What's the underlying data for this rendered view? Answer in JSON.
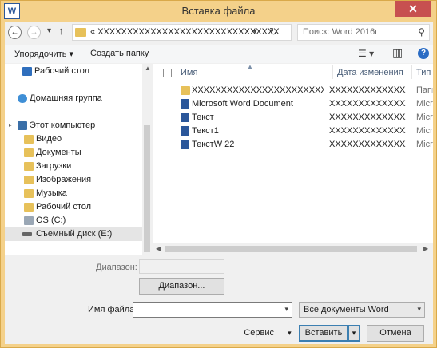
{
  "window": {
    "app_icon_letter": "W",
    "title": "Вставка файла",
    "close_glyph": "✕"
  },
  "nav": {
    "back_glyph": "←",
    "forward_glyph": "→",
    "recent_glyph": "▾",
    "up_glyph": "↑",
    "address_prefix": "«",
    "address_path": "XXXXXXXXXXXXXXXXXXXXXXXXXXXXXXX",
    "address_dropdown_glyph": "▾",
    "refresh_glyph": "↻",
    "search_placeholder": "Поиск: Word 2016г",
    "search_glyph": "⚲"
  },
  "toolbar": {
    "organize_label": "Упорядочить ▾",
    "new_folder_label": "Создать папку",
    "view_glyph": "☰ ▾",
    "preview_glyph": "▥",
    "help_glyph": "?"
  },
  "sidebar": {
    "items": [
      {
        "label": "Рабочий стол",
        "icon": "desktop-icon"
      },
      {
        "label": "Домашняя группа",
        "icon": "homegroup-icon"
      },
      {
        "label": "Этот компьютер",
        "icon": "computer-icon"
      },
      {
        "label": "Видео",
        "icon": "folder-icon"
      },
      {
        "label": "Документы",
        "icon": "folder-icon"
      },
      {
        "label": "Загрузки",
        "icon": "folder-icon"
      },
      {
        "label": "Изображения",
        "icon": "folder-icon"
      },
      {
        "label": "Музыка",
        "icon": "folder-icon"
      },
      {
        "label": "Рабочий стол",
        "icon": "folder-icon"
      },
      {
        "label": "OS (C:)",
        "icon": "drive-icon"
      },
      {
        "label": "Съемный диск (E:)",
        "icon": "removable-drive-icon",
        "selected": true
      }
    ],
    "expand_glyph": "▸"
  },
  "files": {
    "columns": [
      "Имя",
      "Дата изменения",
      "Тип"
    ],
    "rows": [
      {
        "name": "XXXXXXXXXXXXXXXXXXXXXXXXXXXX",
        "date": "XXXXXXXXXXXXXXX",
        "type": "Папка",
        "icon": "folder-icon"
      },
      {
        "name": "Microsoft Word Document",
        "date": "XXXXXXXXXXXXXXX",
        "type": "Micros",
        "icon": "word-doc-icon"
      },
      {
        "name": "Текст",
        "date": "XXXXXXXXXXXXXXX",
        "type": "Micros",
        "icon": "word-doc-icon"
      },
      {
        "name": "Текст1",
        "date": "XXXXXXXXXXXXXXX",
        "type": "Micros",
        "icon": "word-doc-icon"
      },
      {
        "name": "ТекстW 22",
        "date": "XXXXXXXXXXXXXXX",
        "type": "Micros",
        "icon": "word-doc-icon"
      }
    ]
  },
  "bottom": {
    "range_label": "Диапазон:",
    "range_button": "Диапазон...",
    "filename_label": "Имя файла:",
    "filename_value": "",
    "filetype_value": "Все документы Word",
    "tools_label": "Сервис",
    "insert_label": "Вставить",
    "cancel_label": "Отмена",
    "dropdown_glyph": "▾"
  }
}
